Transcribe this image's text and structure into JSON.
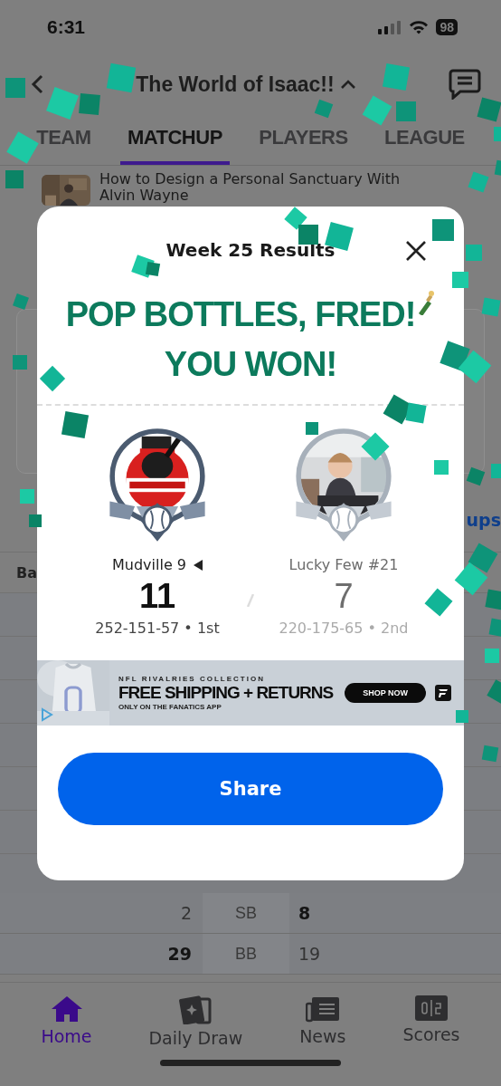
{
  "status_bar": {
    "time": "6:31",
    "battery": "98"
  },
  "header": {
    "title": "The World of Isaac!!"
  },
  "tabs": [
    {
      "label": "TEAM",
      "selected": false
    },
    {
      "label": "MATCHUP",
      "selected": true
    },
    {
      "label": "PLAYERS",
      "selected": false
    },
    {
      "label": "LEAGUE",
      "selected": false
    }
  ],
  "article": {
    "title": "How to Design a Personal Sanctuary With Alvin Wayne"
  },
  "background": {
    "link": "ups",
    "row_label": "Ba",
    "stats": [
      {
        "stat": "SB",
        "left": {
          "value": "2",
          "leading": false
        },
        "right": {
          "value": "8",
          "leading": true
        }
      },
      {
        "stat": "BB",
        "left": {
          "value": "29",
          "leading": true
        },
        "right": {
          "value": "19",
          "leading": false
        }
      }
    ]
  },
  "modal": {
    "title": "Week 25 Results",
    "headline": [
      "POP BOTTLES, FRED!",
      "YOU WON!"
    ],
    "teams": [
      {
        "name": "Mudville 9",
        "mine": true,
        "winner": true,
        "score": "11",
        "record": "252-151-57 • 1st",
        "avatar": {
          "kind": "logo"
        }
      },
      {
        "name": "Lucky Few #21",
        "mine": false,
        "winner": false,
        "score": "7",
        "record": "220-175-65 • 2nd"
      }
    ],
    "ad": {
      "eyebrow": "NFL RIVALRIES COLLECTION",
      "headline": "FREE SHIPPING + RETURNS",
      "subline": "ONLY ON THE FANATICS APP",
      "cta": "SHOP NOW"
    },
    "button": "Share"
  },
  "nav": [
    {
      "label": "Home",
      "kind": "home",
      "selected": true
    },
    {
      "label": "Daily Draw",
      "kind": "card",
      "selected": false
    },
    {
      "label": "News",
      "kind": "news",
      "selected": false
    },
    {
      "label": "Scores",
      "kind": "scores",
      "selected": false
    }
  ]
}
